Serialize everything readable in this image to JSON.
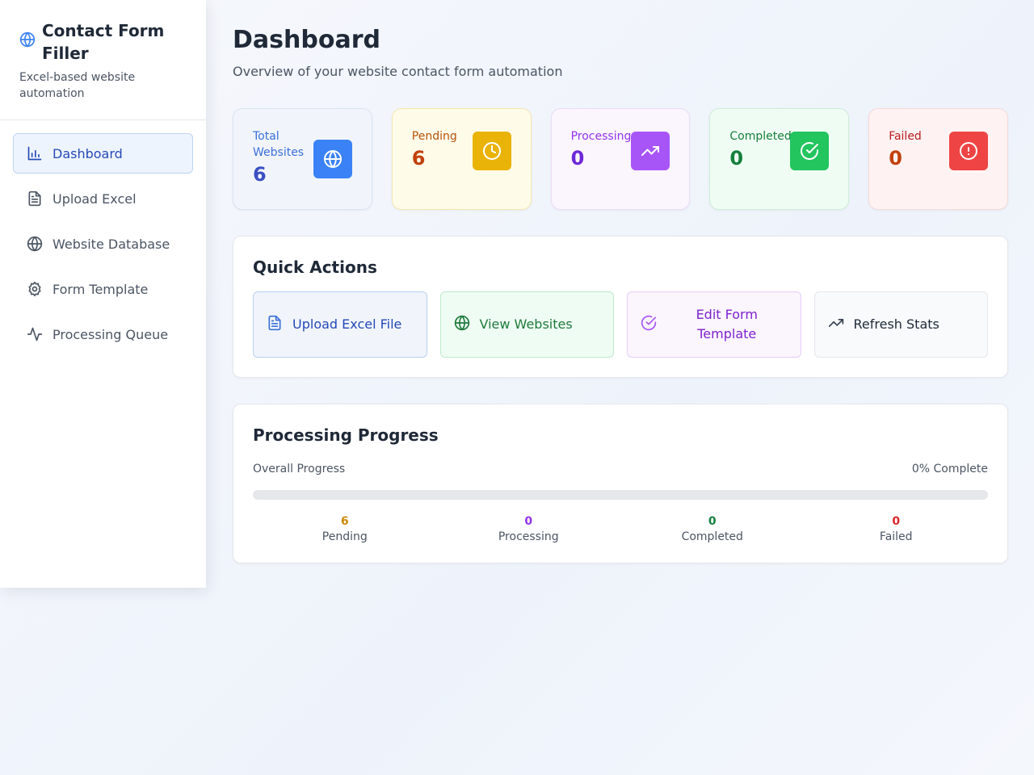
{
  "app": {
    "title": "Contact Form Filler",
    "subtitle": "Excel-based website automation"
  },
  "sidebar": {
    "items": [
      {
        "label": "Dashboard",
        "icon": "bar-chart-icon",
        "active": true
      },
      {
        "label": "Upload Excel",
        "icon": "file-text-icon"
      },
      {
        "label": "Website Database",
        "icon": "globe-icon"
      },
      {
        "label": "Form Template",
        "icon": "gear-icon"
      },
      {
        "label": "Processing Queue",
        "icon": "activity-icon"
      }
    ]
  },
  "header": {
    "title": "Dashboard",
    "subtitle": "Overview of your website contact form automation"
  },
  "stats": {
    "total": {
      "label": "Total Websites",
      "value": "6",
      "icon": "globe-icon",
      "color": "#3b82f6"
    },
    "pending": {
      "label": "Pending",
      "value": "6",
      "icon": "clock-icon",
      "color": "#eab308"
    },
    "processing": {
      "label": "Processing",
      "value": "0",
      "icon": "trending-up-icon",
      "color": "#a855f7"
    },
    "completed": {
      "label": "Completed",
      "value": "0",
      "icon": "check-circle-icon",
      "color": "#22c55e"
    },
    "failed": {
      "label": "Failed",
      "value": "0",
      "icon": "alert-circle-icon",
      "color": "#ef4444"
    }
  },
  "quick_actions": {
    "title": "Quick Actions",
    "buttons": [
      {
        "label": "Upload Excel File",
        "icon": "file-text-icon"
      },
      {
        "label": "View Websites",
        "icon": "globe-icon"
      },
      {
        "label": "Edit Form Template",
        "icon": "check-circle-icon"
      },
      {
        "label": "Refresh Stats",
        "icon": "trending-up-icon"
      }
    ]
  },
  "progress": {
    "title": "Processing Progress",
    "overall_label": "Overall Progress",
    "complete_text": "0% Complete",
    "percent": 0,
    "breakdown": [
      {
        "value": "6",
        "label": "Pending"
      },
      {
        "value": "0",
        "label": "Processing"
      },
      {
        "value": "0",
        "label": "Completed"
      },
      {
        "value": "0",
        "label": "Failed"
      }
    ]
  }
}
